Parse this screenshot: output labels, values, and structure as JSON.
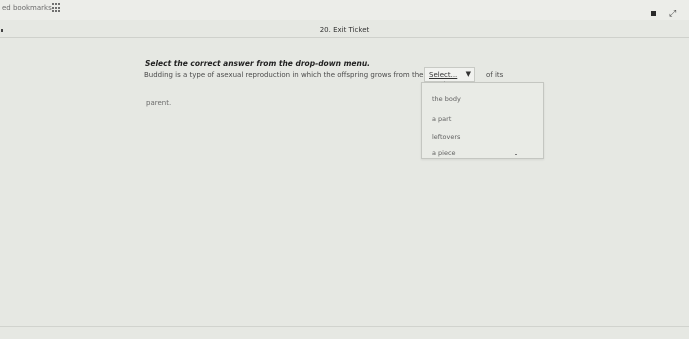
{
  "browser": {
    "bookmarks_label": "ed bookmarks"
  },
  "page": {
    "title": "20. Exit Ticket"
  },
  "question": {
    "instruction": "Select the correct answer from the drop-down menu.",
    "text_before": "Budding is a type of asexual reproduction in which the offspring grows from the",
    "text_after": "of its",
    "text_end": "parent."
  },
  "dropdown": {
    "selected": "Select...",
    "options": [
      "the body",
      "a part",
      "leftovers",
      "a piece"
    ]
  },
  "icons": {
    "apps": "apps-grid-icon",
    "extension": "square-icon",
    "expand": "expand-icon",
    "chevron": "chevron-down-icon",
    "cursor": "pointer-cursor-icon"
  }
}
